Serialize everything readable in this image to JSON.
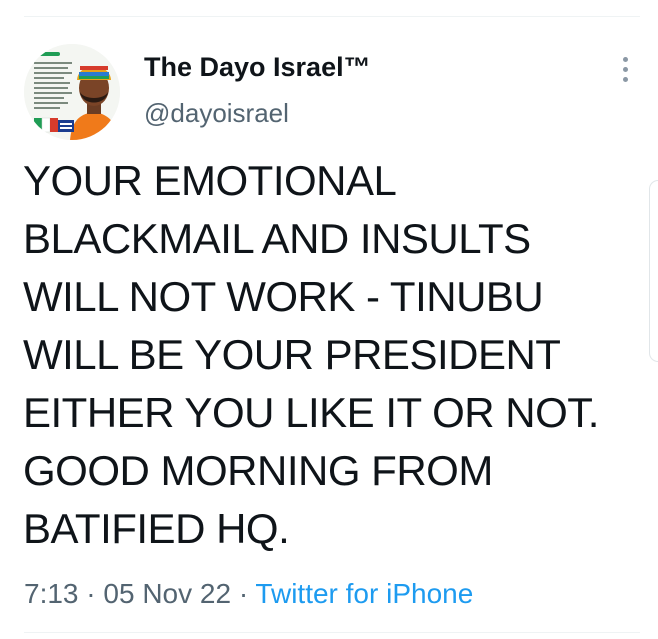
{
  "tweet": {
    "display_name": "The Dayo Israel™",
    "handle": "@dayoisrael",
    "avatar_text": "DAYO ISRAEL",
    "text_lines": [
      "YOUR EMOTIONAL",
      "BLACKMAIL AND INSULTS",
      "WILL NOT WORK - TINUBU",
      "WILL BE YOUR PRESIDENT",
      "EITHER YOU LIKE IT OR NOT.",
      "GOOD MORNING FROM",
      "BATIFIED HQ."
    ],
    "time": "7:13",
    "separator": "·",
    "date": "05 Nov 22",
    "source": "Twitter for iPhone"
  },
  "icons": {
    "more": "more-vertical-icon"
  },
  "colors": {
    "text": "#0f1419",
    "secondary": "#536471",
    "link": "#1d9bf0"
  }
}
